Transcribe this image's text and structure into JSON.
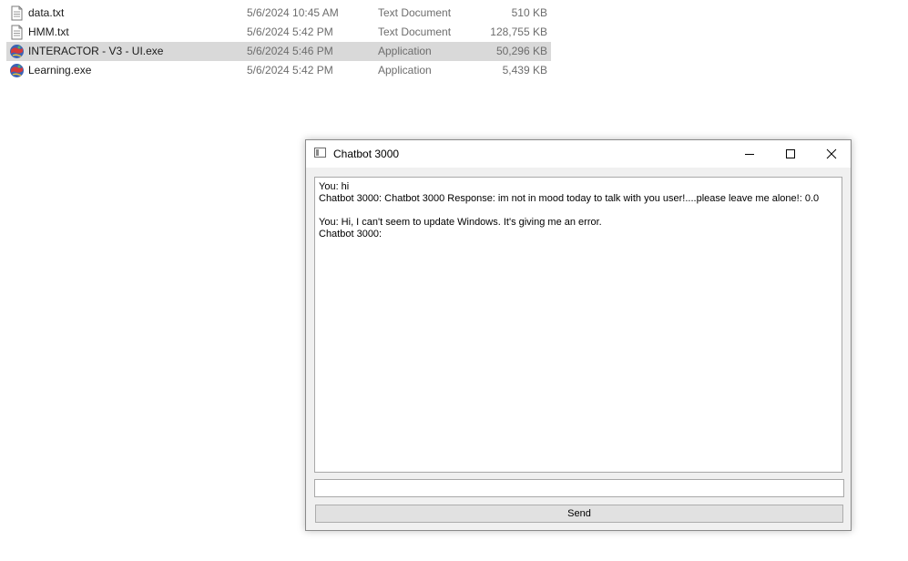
{
  "explorer": {
    "files": [
      {
        "name": "data.txt",
        "date": "5/6/2024 10:45 AM",
        "type": "Text Document",
        "size": "510 KB",
        "icon": "text-document-icon"
      },
      {
        "name": "HMM.txt",
        "date": "5/6/2024 5:42 PM",
        "type": "Text Document",
        "size": "128,755 KB",
        "icon": "text-document-icon"
      },
      {
        "name": "INTERACTOR - V3 - UI.exe",
        "date": "5/6/2024 5:46 PM",
        "type": "Application",
        "size": "50,296 KB",
        "icon": "application-icon",
        "selected": true
      },
      {
        "name": "Learning.exe",
        "date": "5/6/2024 5:42 PM",
        "type": "Application",
        "size": "5,439 KB",
        "icon": "application-icon"
      }
    ]
  },
  "chat_window": {
    "title": "Chatbot 3000",
    "transcript": [
      "You: hi",
      "Chatbot 3000: Chatbot 3000 Response: im not in mood today to talk with you user!....please leave me alone!: 0.0",
      "",
      "You: Hi, I can't seem to update Windows. It's giving me an error.",
      "Chatbot 3000:"
    ],
    "input_value": "",
    "send_label": "Send"
  },
  "colors": {
    "selected_row_bg": "#d9d9d9",
    "window_bg": "#f0f0f0",
    "button_bg": "#e1e1e1"
  }
}
